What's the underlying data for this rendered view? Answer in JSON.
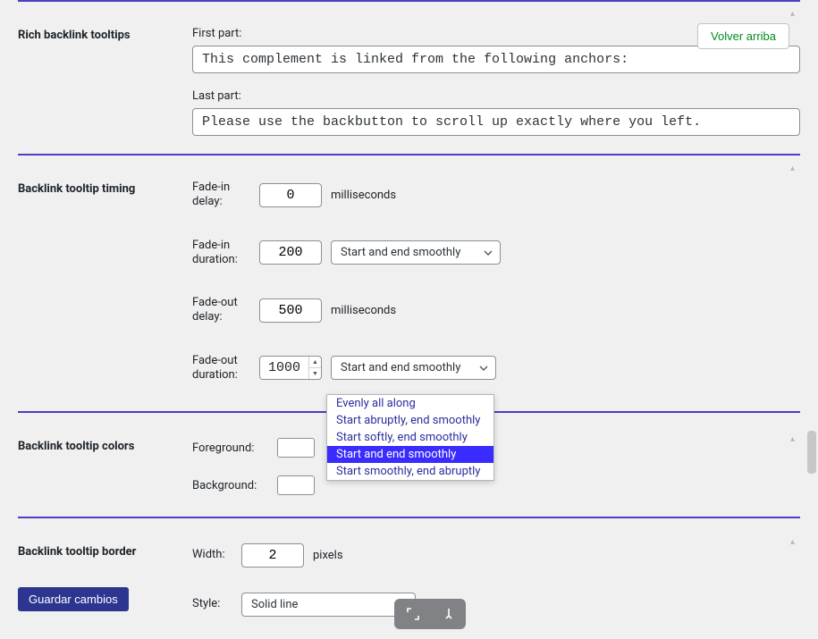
{
  "backToTop": "Volver arriba",
  "saveButton": "Guardar cambios",
  "sections": {
    "richTooltips": {
      "title": "Rich backlink tooltips",
      "firstPartLabel": "First part:",
      "firstPartValue": "This complement is linked from the following anchors:",
      "lastPartLabel": "Last part:",
      "lastPartValue": "Please use the backbutton to scroll up exactly where you left."
    },
    "timing": {
      "title": "Backlink tooltip timing",
      "fadeInDelayLabel": "Fade-in delay:",
      "fadeInDelayValue": "0",
      "fadeInDurationLabel": "Fade-in duration:",
      "fadeInDurationValue": "200",
      "fadeInDurationCurve": "Start and end smoothly",
      "fadeOutDelayLabel": "Fade-out delay:",
      "fadeOutDelayValue": "500",
      "fadeOutDurationLabel": "Fade-out duration:",
      "fadeOutDurationValue": "1000",
      "fadeOutDurationCurve": "Start and end smoothly",
      "msUnit": "milliseconds"
    },
    "colors": {
      "title": "Backlink tooltip colors",
      "foregroundLabel": "Foreground:",
      "foregroundValue": "#000000",
      "backgroundLabel": "Background:",
      "backgroundValue": "#ffffff"
    },
    "border": {
      "title": "Backlink tooltip border",
      "widthLabel": "Width:",
      "widthValue": "2",
      "widthUnit": "pixels",
      "styleLabel": "Style:",
      "styleValue": "Solid line"
    }
  },
  "curveOptions": [
    "Evenly all along",
    "Start abruptly, end smoothly",
    "Start softly, end smoothly",
    "Start and end smoothly",
    "Start smoothly, end abruptly"
  ],
  "curveSelectedIndex": 3
}
